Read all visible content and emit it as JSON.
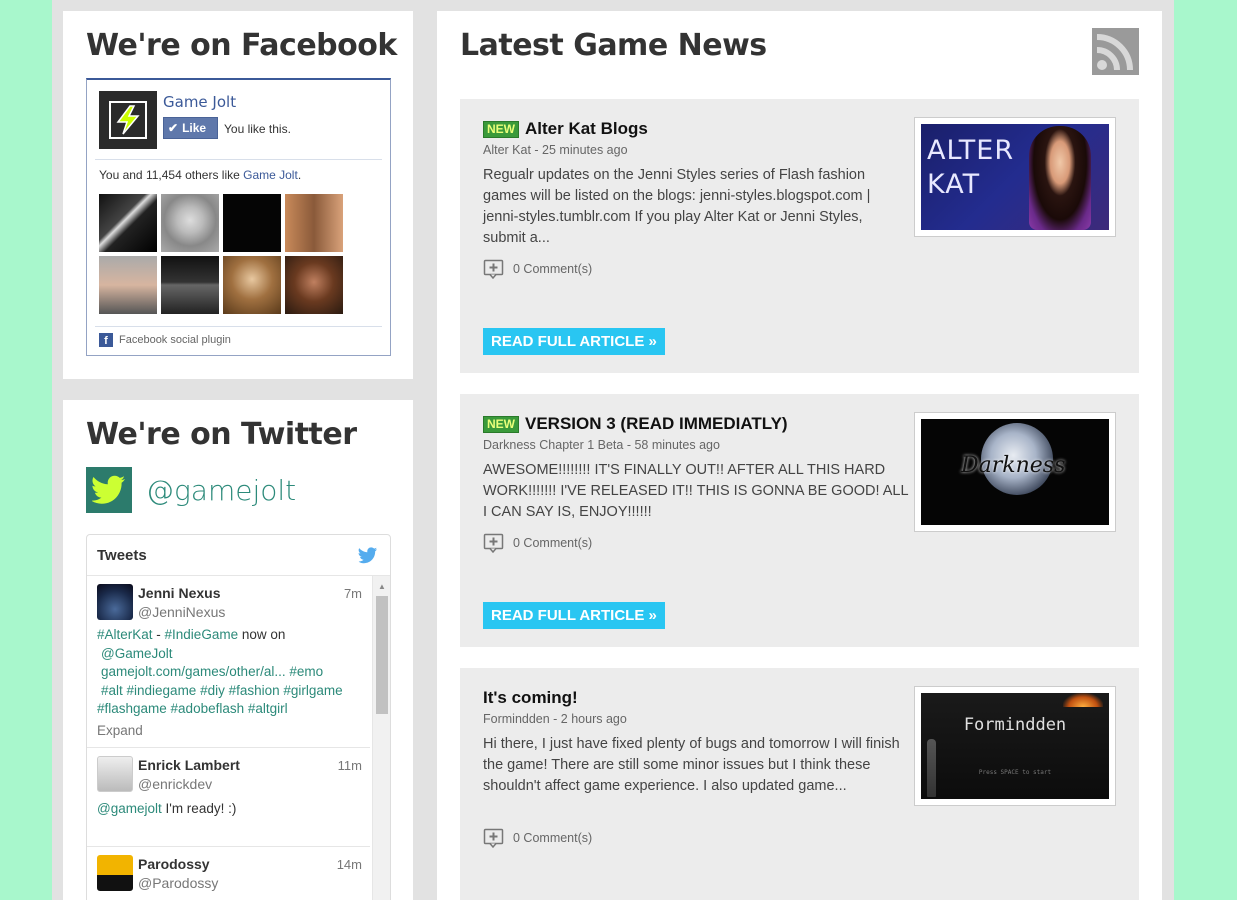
{
  "facebook": {
    "title": "We're on Facebook",
    "page_name": "Game Jolt",
    "like_label": "Like",
    "you_like": "You like this.",
    "count_prefix": "You and 11,454 others like ",
    "count_link": "Game Jolt",
    "count_suffix": ".",
    "plugin_label": "Facebook social plugin"
  },
  "twitter": {
    "title": "We're on Twitter",
    "handle": "@gamejolt",
    "box_title": "Tweets",
    "tweets": [
      {
        "name": "Jenni Nexus",
        "user": "@JenniNexus",
        "time": "7m",
        "line1_a": "#AlterKat",
        "line1_b": " - ",
        "line1_c": "#IndieGame",
        "line1_d": " now on",
        "line2": "@GameJolt",
        "line3": "gamejolt.com/games/other/al... #emo",
        "line4": "#alt #indiegame #diy #fashion #girlgame",
        "line5": "#flashgame #adobeflash #altgirl",
        "expand": "Expand"
      },
      {
        "name": "Enrick Lambert",
        "user": "@enrickdev",
        "time": "11m",
        "mention": "@gamejolt",
        "text": " I'm ready! :)"
      },
      {
        "name": "Parodossy",
        "user": "@Parodossy",
        "time": "14m"
      }
    ]
  },
  "news": {
    "title": "Latest Game News",
    "items": [
      {
        "badge": "NEW",
        "title": "Alter Kat Blogs",
        "meta": "Alter Kat - 25 minutes ago",
        "body": "Regualr updates on the Jenni Styles series of Flash fashion games will be listed on the blogs: jenni-styles.blogspot.com | jenni-styles.tumblr.com If you play Alter Kat or Jenni Styles, submit a...",
        "comments": "0 Comment(s)",
        "read_more": "READ FULL ARTICLE »",
        "thumb_text": "ALTER KAT"
      },
      {
        "badge": "NEW",
        "title": "VERSION 3 (READ IMMEDIATLY)",
        "meta": "Darkness Chapter 1 Beta - 58 minutes ago",
        "body": "AWESOME!!!!!!!! IT'S FINALLY OUT!! AFTER ALL THIS HARD WORK!!!!!!! I'VE RELEASED IT!! THIS IS GONNA BE GOOD! ALL I CAN SAY IS, ENJOY!!!!!!",
        "comments": "0 Comment(s)",
        "read_more": "READ FULL ARTICLE »",
        "thumb_text": "Darkness"
      },
      {
        "title": "It's coming!",
        "meta": "Formindden - 2 hours ago",
        "body": "Hi there, I just have fixed plenty of bugs and tomorrow I will finish the game! There are still some minor issues but I think these shouldn't affect game experience. I also updated game...",
        "comments": "0 Comment(s)",
        "thumb_text": "Formindden",
        "thumb_sub": "Press SPACE to start"
      }
    ]
  },
  "colors": {
    "page_bg": "#a8f7cc",
    "accent_button": "#29c6f2",
    "new_badge": "#3a9a3a",
    "facebook_blue": "#3b5998",
    "twitter_teal": "#2c8a7a"
  }
}
